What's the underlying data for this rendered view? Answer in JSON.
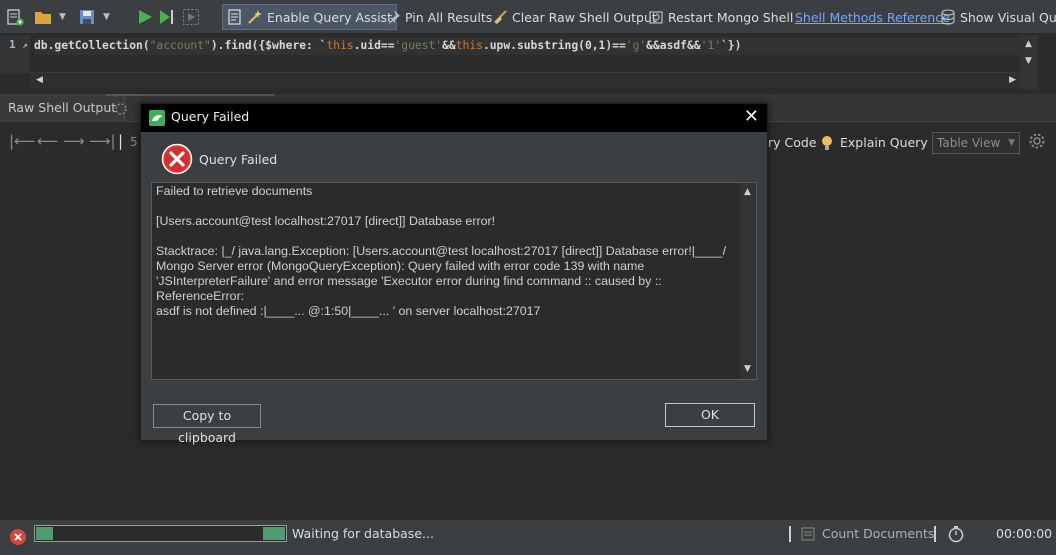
{
  "toolbar": {
    "enable_query_assist": "Enable Query Assist",
    "pin_all_results": "Pin All Results",
    "clear_raw_shell_output": "Clear Raw Shell Output",
    "restart_mongo_shell": "Restart Mongo Shell",
    "shell_methods_reference": "Shell Methods Reference",
    "show_visual": "Show Visual Que"
  },
  "editor": {
    "line_number": "1",
    "code_db": "db.getCollection(",
    "code_coll": "\"account\"",
    "code_find": ").find({$where: `",
    "code_this1": "this",
    "code_uid": ".uid==",
    "code_guest": "'guest'",
    "code_and1": "&&",
    "code_this2": "this",
    "code_sub": ".upw.substring(0,1)==",
    "code_g": "'g'",
    "code_rest": "&&asdf&&",
    "code_one": "'1'",
    "code_end": "`})"
  },
  "results": {
    "tab_raw": "Raw Shell Output",
    "query_code": "ry Code",
    "explain_query": "Explain Query",
    "table_view": "Table View",
    "page_field": "5"
  },
  "dialog": {
    "title": "Query Failed",
    "heading": "Query Failed",
    "message": "Failed to retrieve documents\n\n[Users.account@test localhost:27017 [direct]] Database error!\n\nStacktrace: |_/ java.lang.Exception: [Users.account@test localhost:27017 [direct]] Database error!|____/\nMongo Server error (MongoQueryException): Query failed with error code 139 with name\n'JSInterpreterFailure' and error message 'Executor error during find command :: caused by :: ReferenceError:\nasdf is not defined :|____... @:1:50|____... ' on server localhost:27017",
    "copy_button": "Copy to clipboard",
    "ok_button": "OK"
  },
  "status": {
    "text": "Waiting for database...",
    "count_documents": "Count Documents",
    "elapsed": "00:00:00"
  },
  "colors": {
    "accent_link": "#6fa8ff",
    "progress_fill": "#4f9a6e",
    "error_red": "#d32f2f"
  }
}
